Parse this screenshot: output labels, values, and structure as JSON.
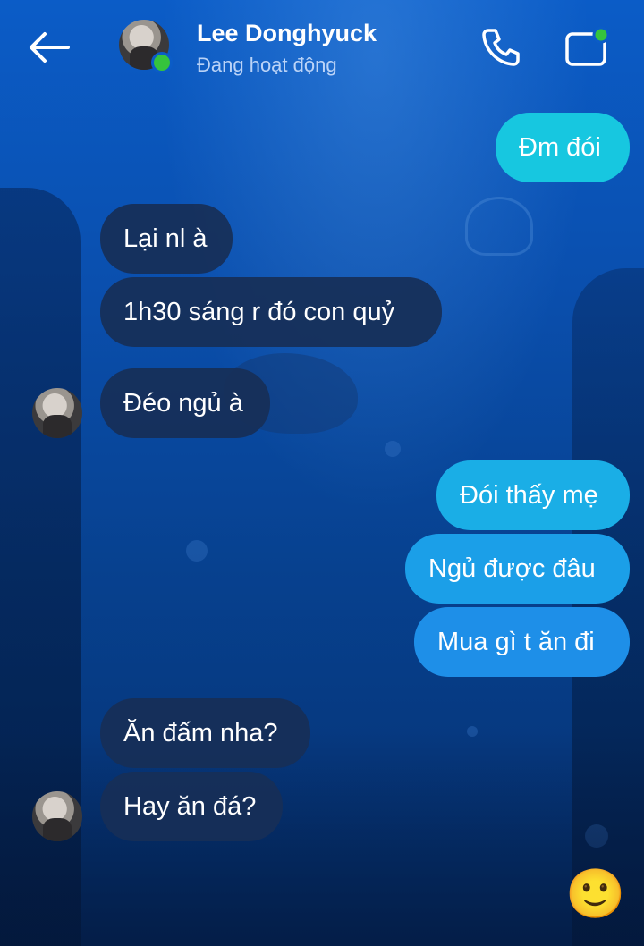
{
  "header": {
    "contact_name": "Lee Donghyuck",
    "status": "Đang hoạt động",
    "icons": {
      "back": "back-arrow-icon",
      "call": "phone-icon",
      "video": "video-camera-icon"
    }
  },
  "messages": [
    {
      "sender": "me",
      "text": "Đm đói"
    },
    {
      "sender": "them",
      "text": "Lại nl à"
    },
    {
      "sender": "them",
      "text": "1h30 sáng r đó con quỷ"
    },
    {
      "sender": "them",
      "text": "Đéo ngủ à"
    },
    {
      "sender": "me",
      "text": "Đói thấy mẹ"
    },
    {
      "sender": "me",
      "text": "Ngủ được đâu"
    },
    {
      "sender": "me",
      "text": "Mua gì t ăn đi"
    },
    {
      "sender": "them",
      "text": "Ăn đấm nha?"
    },
    {
      "sender": "them",
      "text": "Hay ăn đá?"
    }
  ],
  "composer": {
    "emoji": "🙂"
  },
  "colors": {
    "outgoing_top": "#17c7e0",
    "outgoing_mid": "#1ba3e8",
    "outgoing_bottom": "#1e8fe8",
    "incoming": "#172f57",
    "online": "#35c43d"
  }
}
